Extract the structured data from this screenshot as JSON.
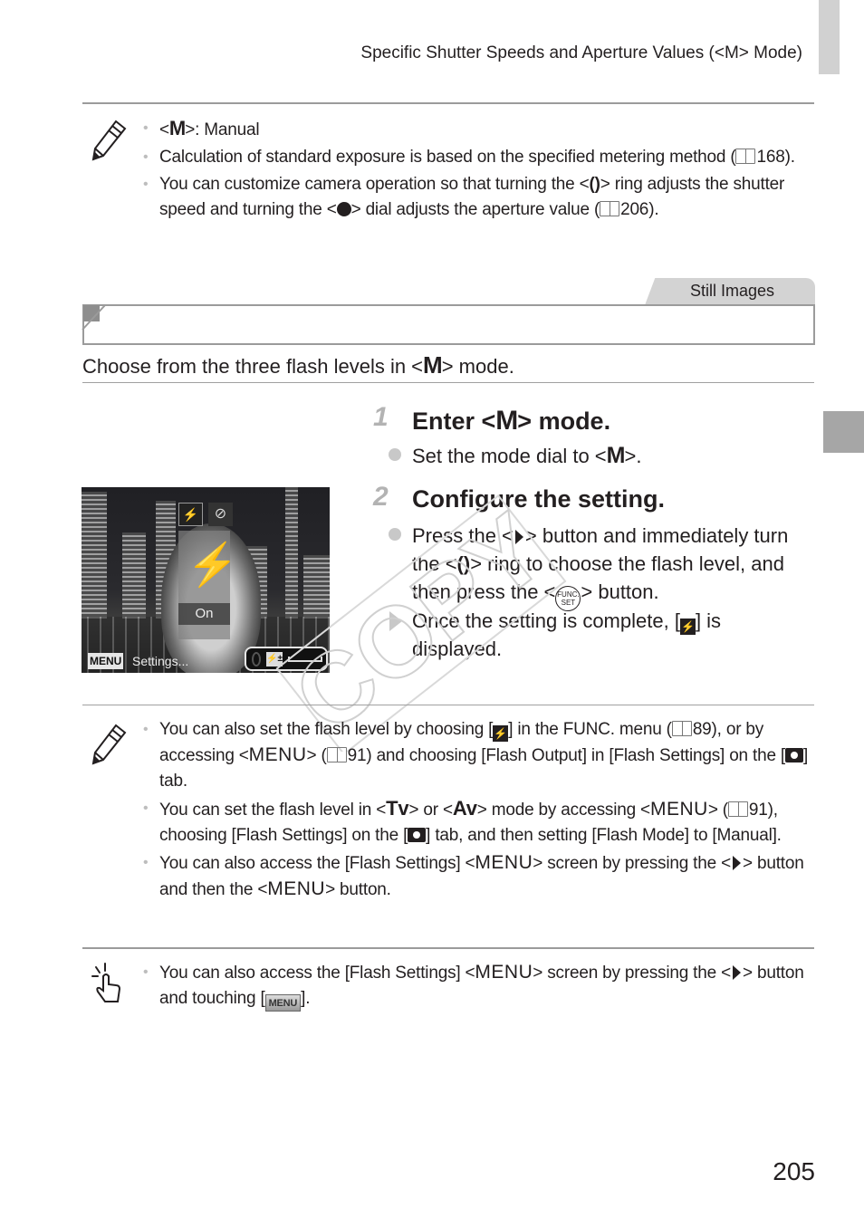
{
  "header": {
    "running_head": "Specific Shutter Speeds and Aperture Values (<M> Mode)"
  },
  "note1": {
    "icon": "pencil-icon",
    "items": [
      {
        "pre": "<",
        "glyph": "M",
        "post": ">: Manual"
      },
      {
        "text": "Calculation of standard exposure is based on the specified metering method (",
        "ref": "168",
        "tail": ")."
      },
      {
        "a": "You can customize camera operation so that turning the <",
        "ring": "()",
        "b": "> ring adjusts the shutter speed and turning the <",
        "c": "> dial adjusts the aperture value (",
        "ref": "206",
        "tail": ")."
      }
    ]
  },
  "section": {
    "tab_label": "Still Images",
    "title": "",
    "intro_pre": "Choose from the three flash levels in <",
    "intro_glyph": "M",
    "intro_post": "> mode."
  },
  "camera_screen": {
    "flash_on_label": "On",
    "menu_chip": "MENU",
    "settings_label": "Settings...",
    "flash_icon": "lightning-icon",
    "flash_off_icon": "flash-off-icon"
  },
  "steps": [
    {
      "number": "1",
      "title_pre": "Enter <",
      "title_glyph": "M",
      "title_post": "> mode.",
      "bullets": [
        {
          "pre": "Set the mode dial to <",
          "glyph": "M",
          "post": ">."
        }
      ]
    },
    {
      "number": "2",
      "title": "Configure the setting.",
      "line1a": "Press the <",
      "line1b": "> button and immediately turn the <",
      "ring": "()",
      "line1c": "> ring to choose the flash level, and then press the <",
      "func_top": "FUNC.",
      "func_bottom": "SET",
      "line1d": "> button.",
      "result_pre": "Once the setting is complete, [",
      "result_post": "] is displayed."
    }
  ],
  "note2": {
    "icon": "pencil-icon",
    "items": [
      {
        "a": "You can also set the flash level by choosing [",
        "b": "] in the FUNC. menu (",
        "ref1": "89",
        "c": "), or by accessing <",
        "menu": "MENU",
        "d": "> (",
        "ref2": "91",
        "e": ") and choosing [Flash Output] in [Flash Settings] on the [",
        "f": "] tab."
      },
      {
        "a": "You can set the flash level in <",
        "tv": "Tv",
        "b": "> or <",
        "av": "Av",
        "c": "> mode by accessing <",
        "menu": "MENU",
        "d": "> (",
        "ref": "91",
        "e": "), choosing [Flash Settings] on the [",
        "f": "] tab, and then setting [Flash Mode] to [Manual]."
      },
      {
        "a": "You can also access the [Flash Settings] <",
        "menu": "MENU",
        "b": "> screen by pressing the <",
        "c": "> button and then the <",
        "menu2": "MENU",
        "d": "> button."
      }
    ]
  },
  "note3": {
    "icon": "touch-icon",
    "items": [
      {
        "a": "You can also access the [Flash Settings] <",
        "menu": "MENU",
        "b": "> screen by pressing the <",
        "c": "> button and touching [",
        "btn": "MENU",
        "d": "]."
      }
    ]
  },
  "watermark": "COPY",
  "page_number": "205"
}
